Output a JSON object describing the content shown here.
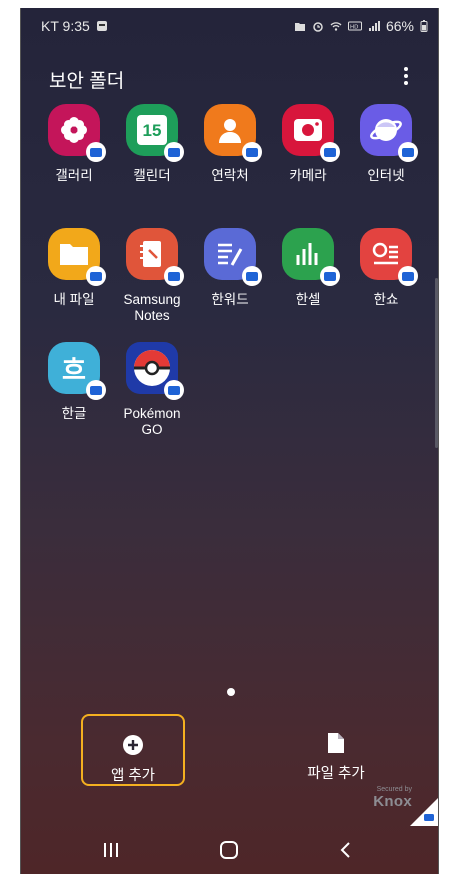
{
  "status": {
    "carrier_time": "KT 9:35",
    "battery": "66%"
  },
  "header": {
    "title": "보안 폴더"
  },
  "apps": [
    {
      "label": "갤러리",
      "icon": "gallery-icon",
      "color": "#c4155a"
    },
    {
      "label": "캘린더",
      "icon": "calendar-icon",
      "color": "#1e9e5a",
      "icon_text": "15"
    },
    {
      "label": "연락처",
      "icon": "contacts-icon",
      "color": "#f07a1c"
    },
    {
      "label": "카메라",
      "icon": "camera-icon",
      "color": "#d8163c"
    },
    {
      "label": "인터넷",
      "icon": "internet-icon",
      "color": "#6a5ce6"
    },
    {
      "label": "내 파일",
      "icon": "my-files-icon",
      "color": "#f2a81a"
    },
    {
      "label": "Samsung Notes",
      "icon": "samsung-notes-icon",
      "color": "#e0553a"
    },
    {
      "label": "한워드",
      "icon": "hanword-icon",
      "color": "#5a6ad6"
    },
    {
      "label": "한셀",
      "icon": "hancell-icon",
      "color": "#2ca24e"
    },
    {
      "label": "한쇼",
      "icon": "hanshow-icon",
      "color": "#e34340"
    },
    {
      "label": "한글",
      "icon": "hangul-icon",
      "color": "#3fb0d8",
      "icon_text": "흐"
    },
    {
      "label": "Pokémon GO",
      "icon": "pokemon-go-icon",
      "color": "#1f3aa8"
    }
  ],
  "actions": {
    "add_app": "앱 추가",
    "add_file": "파일 추가"
  },
  "knox": {
    "secured_by": "Secured by",
    "brand": "Knox"
  },
  "colors": {
    "highlight": "#f4b020",
    "badge": "#1e63d6"
  }
}
